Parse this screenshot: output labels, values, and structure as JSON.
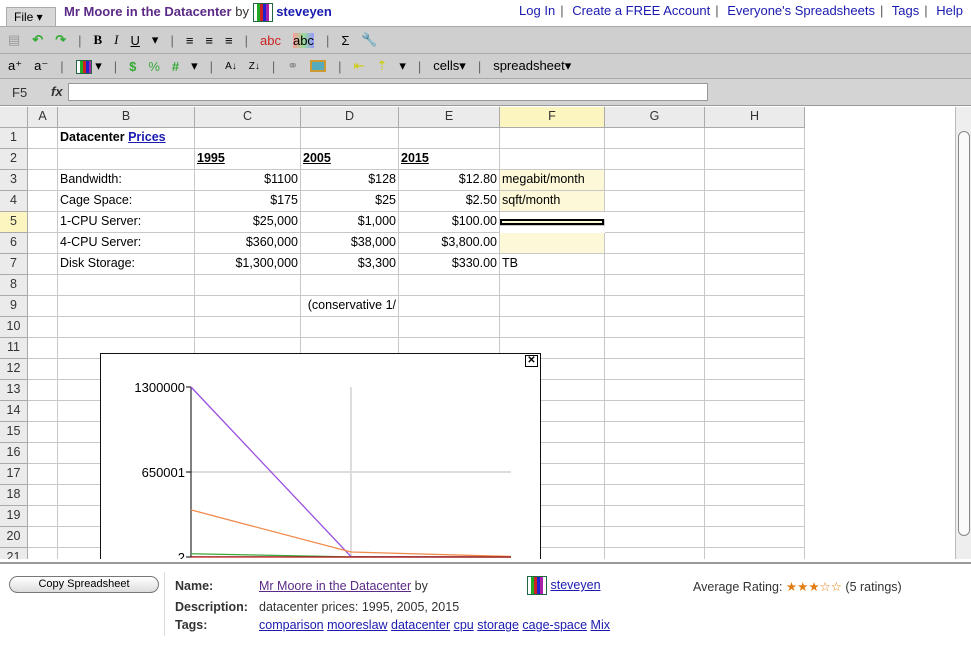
{
  "header": {
    "file_menu": "File ▾",
    "title": "Mr Moore in the Datacenter",
    "by": "by",
    "author": "steveyen",
    "links": [
      "Log In",
      "Create a FREE Account",
      "Everyone's Spreadsheets",
      "Tags",
      "Help"
    ]
  },
  "toolbar1": [
    "B",
    "I",
    "U",
    "abc",
    "abc",
    "Σ"
  ],
  "toolbar2": {
    "cells": "cells▾",
    "spreadsheet": "spreadsheet▾"
  },
  "formula": {
    "cell_ref": "F5",
    "fx": "fx",
    "value": ""
  },
  "columns": [
    "A",
    "B",
    "C",
    "D",
    "E",
    "F",
    "G",
    "H"
  ],
  "selected_cell": "F5",
  "rows": [
    [
      "",
      "Datacenter Prices",
      "",
      "",
      "",
      "",
      "",
      ""
    ],
    [
      "",
      "",
      "1995",
      "2005",
      "2015",
      "",
      "",
      ""
    ],
    [
      "",
      "Bandwidth:",
      "$1100",
      "$128",
      "$12.80",
      "megabit/month",
      "",
      ""
    ],
    [
      "",
      "Cage Space:",
      "$175",
      "$25",
      "$2.50",
      "sqft/month",
      "",
      ""
    ],
    [
      "",
      "1-CPU Server:",
      "$25,000",
      "$1,000",
      "$100.00",
      "",
      "",
      ""
    ],
    [
      "",
      "4-CPU Server:",
      "$360,000",
      "$38,000",
      "$3,800.00",
      "",
      "",
      ""
    ],
    [
      "",
      "Disk Storage:",
      "$1,300,000",
      "$3,300",
      "$330.00",
      "TB",
      "",
      ""
    ],
    [
      "",
      "",
      "",
      "",
      "",
      "",
      "",
      ""
    ],
    [
      "",
      "",
      "",
      "(conservative 1/",
      "",
      "",
      "",
      ""
    ],
    [
      "",
      "",
      "",
      "",
      "",
      "",
      "",
      ""
    ],
    [
      "",
      "",
      "",
      "",
      "",
      "",
      "",
      ""
    ],
    [
      "",
      "",
      "",
      "",
      "",
      "",
      "",
      ""
    ],
    [
      "",
      "",
      "",
      "",
      "",
      "",
      "",
      ""
    ],
    [
      "",
      "",
      "",
      "",
      "",
      "",
      "",
      ""
    ],
    [
      "",
      "",
      "",
      "",
      "",
      "",
      "",
      ""
    ],
    [
      "",
      "",
      "",
      "",
      "",
      "",
      "",
      ""
    ],
    [
      "",
      "",
      "",
      "",
      "",
      "",
      "",
      ""
    ],
    [
      "",
      "",
      "",
      "",
      "",
      "",
      "",
      ""
    ],
    [
      "",
      "",
      "",
      "",
      "",
      "",
      "",
      ""
    ],
    [
      "",
      "",
      "",
      "",
      "",
      "",
      "",
      ""
    ],
    [
      "",
      "",
      "",
      "",
      "",
      "",
      "",
      ""
    ]
  ],
  "chart_data": {
    "type": "line",
    "x": [
      "1995",
      "2005",
      "2015"
    ],
    "ytick_labels": [
      "1300000",
      "650001",
      "2"
    ],
    "ylim": [
      2,
      1300000
    ],
    "grid": true,
    "series": [
      {
        "values": [
          1300000,
          3300,
          330
        ],
        "color": "#9b4fe0"
      },
      {
        "values": [
          360000,
          38000,
          3800
        ],
        "color": "#f08a4b"
      },
      {
        "values": [
          25000,
          1000,
          100
        ],
        "color": "#3aa83a"
      },
      {
        "values": [
          1100,
          128,
          12.8
        ],
        "color": "#333333"
      },
      {
        "values": [
          175,
          25,
          2.5
        ],
        "color": "#c02020"
      }
    ]
  },
  "footer": {
    "copy_button": "Copy Spreadsheet",
    "name_label": "Name:",
    "name": "Mr Moore in the Datacenter",
    "by": "by",
    "author": "steveyen",
    "description_label": "Description:",
    "description": "datacenter prices: 1995, 2005, 2015",
    "tags_label": "Tags:",
    "tags": [
      "comparison",
      "mooreslaw",
      "datacenter",
      "cpu",
      "storage",
      "cage-space",
      "Mix"
    ],
    "rating_label": "Average Rating:",
    "rating": 3,
    "rating_max": 5,
    "stars": "★★★☆☆",
    "rating_count": "(5 ratings)"
  }
}
